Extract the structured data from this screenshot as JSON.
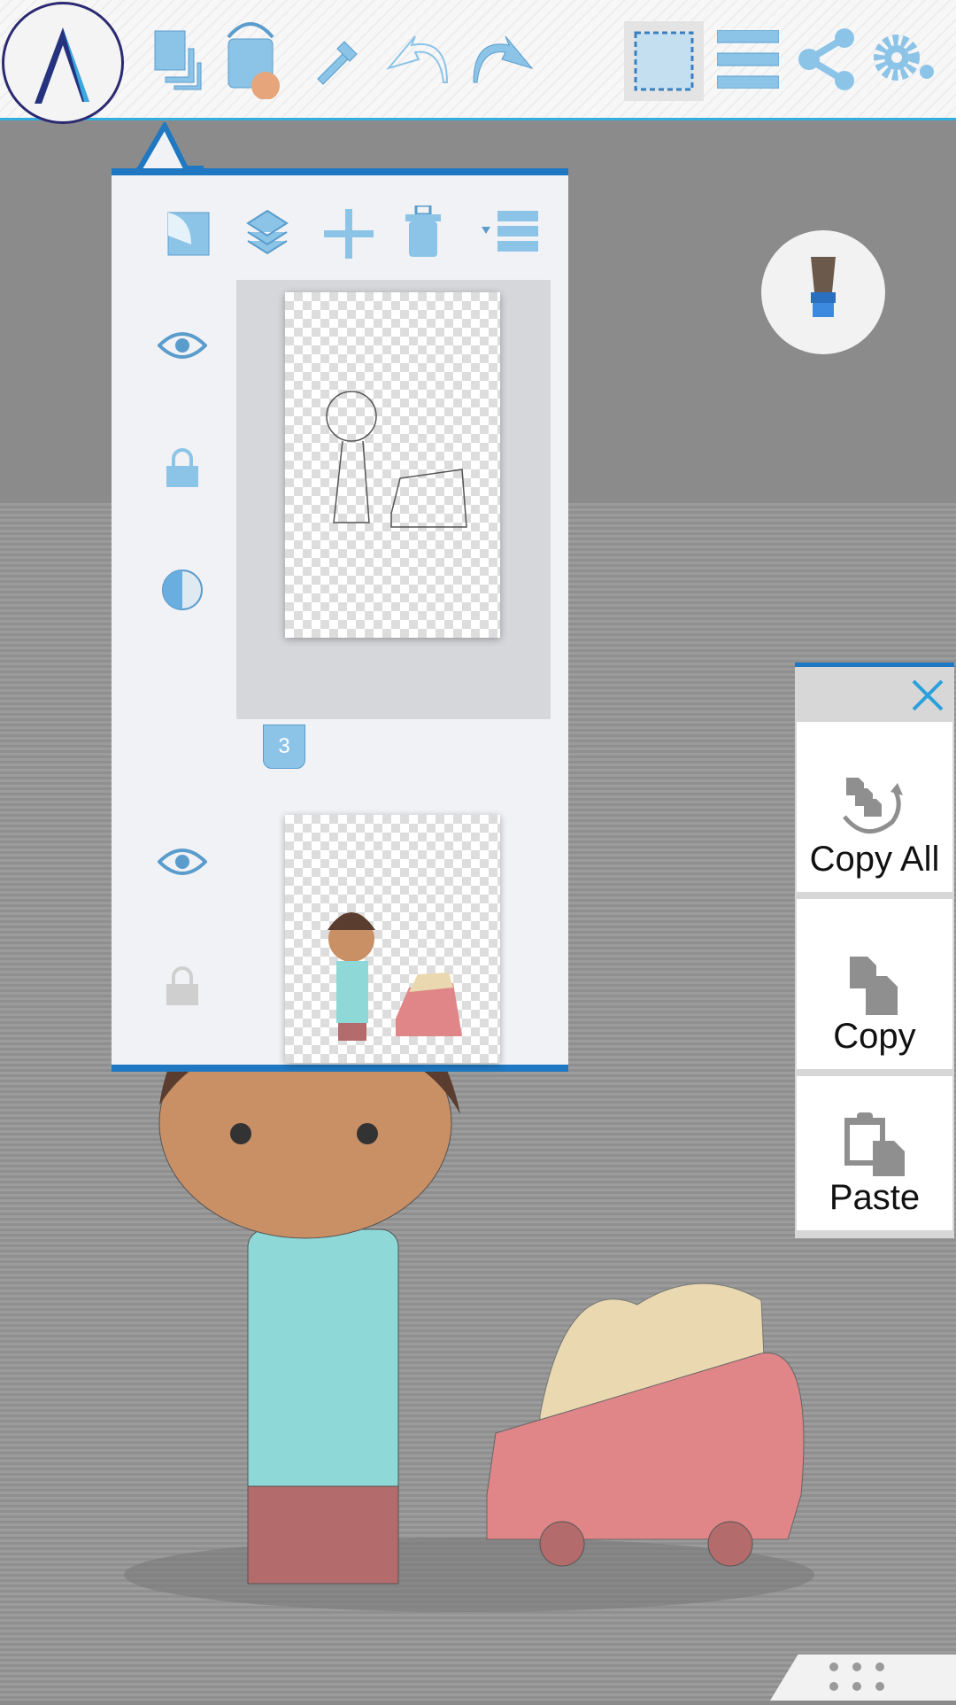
{
  "toolbar": {
    "icons": [
      "app-logo-icon",
      "layers-icon",
      "paint-bucket-icon",
      "eyedropper-icon",
      "undo-icon",
      "redo-icon",
      "selection-icon",
      "menu-icon",
      "share-icon",
      "settings-icon"
    ],
    "accent": "#33aee0",
    "current_color": "#e6a57a"
  },
  "layers_panel": {
    "actions": [
      "new-layer-icon",
      "merge-layers-icon",
      "add-icon",
      "trash-icon",
      "layer-menu-icon"
    ],
    "selected_layer_badge": "3",
    "layers": [
      {
        "visible": true,
        "locked": true,
        "selected": true
      },
      {
        "visible": true,
        "locked": false,
        "selected": false
      }
    ]
  },
  "copy_panel": {
    "copy_all": "Copy All",
    "copy": "Copy",
    "paste": "Paste"
  }
}
